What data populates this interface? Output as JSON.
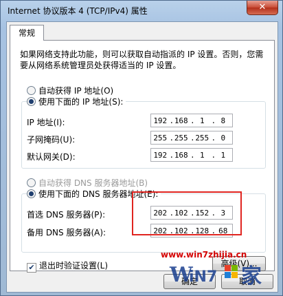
{
  "window": {
    "title": "Internet 协议版本 4 (TCP/IPv4) 属性",
    "close_glyph": "✕"
  },
  "tab": {
    "label": "常规"
  },
  "description": "如果网络支持此功能，则可以获取自动指派的 IP 设置。否则，您需要从网络系统管理员处获得适当的 IP 设置。",
  "ip_section": {
    "auto_label": "自动获得 IP 地址(O)",
    "manual_label": "使用下面的 IP 地址(S):",
    "selected": "manual",
    "fields": [
      {
        "label": "IP 地址(I):",
        "octets": [
          "192",
          "168",
          "1",
          "8"
        ]
      },
      {
        "label": "子网掩码(U):",
        "octets": [
          "255",
          "255",
          "255",
          "0"
        ]
      },
      {
        "label": "默认网关(D):",
        "octets": [
          "192",
          "168",
          "1",
          "1"
        ]
      }
    ]
  },
  "dns_section": {
    "auto_label": "自动获得 DNS 服务器地址(B)",
    "manual_label": "使用下面的 DNS 服务器地址(E):",
    "selected": "manual",
    "fields": [
      {
        "label": "首选 DNS 服务器(P):",
        "octets": [
          "202",
          "102",
          "152",
          "3"
        ]
      },
      {
        "label": "备用 DNS 服务器(A):",
        "octets": [
          "202",
          "102",
          "128",
          "68"
        ]
      }
    ]
  },
  "validate_checkbox": {
    "label": "退出时验证设置(L)",
    "checked": true,
    "mark": "✔"
  },
  "buttons": {
    "advanced": "高级(V)...",
    "ok": "确定",
    "cancel": "取消"
  },
  "watermark": {
    "url": "www.win7zhijia.cn",
    "logo_text": "WiN7",
    "logo_suffix": "家"
  },
  "colors": {
    "highlight": "#e0241f",
    "watermark": "#d40000"
  }
}
